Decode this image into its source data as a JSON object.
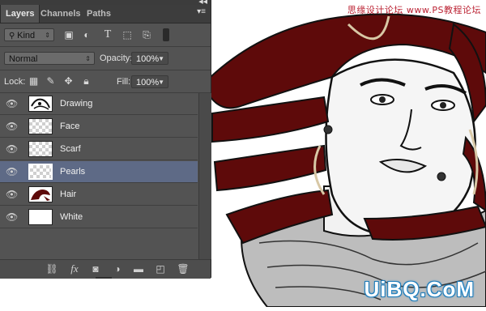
{
  "watermarks": {
    "top": "思缘设计论坛 www.PS教程论坛",
    "bottom": "UiBQ.CoM"
  },
  "panel": {
    "tabs": [
      {
        "label": "Layers",
        "active": true
      },
      {
        "label": "Channels",
        "active": false
      },
      {
        "label": "Paths",
        "active": false
      }
    ],
    "filter": {
      "kind_label": "Kind",
      "icons": [
        "pixel-filter-icon",
        "adjustment-filter-icon",
        "type-filter-icon",
        "shape-filter-icon",
        "smart-object-filter-icon"
      ]
    },
    "blend_mode": "Normal",
    "opacity_label": "Opacity:",
    "opacity_value": "100%",
    "lock_label": "Lock:",
    "lock_icons": [
      "lock-transparent-icon",
      "lock-image-icon",
      "lock-position-icon",
      "lock-all-icon"
    ],
    "fill_label": "Fill:",
    "fill_value": "100%",
    "layers": [
      {
        "name": "Drawing",
        "thumb": "drawing",
        "visible": true,
        "selected": false
      },
      {
        "name": "Face",
        "thumb": "checker",
        "visible": true,
        "selected": false
      },
      {
        "name": "Scarf",
        "thumb": "checker",
        "visible": true,
        "selected": false
      },
      {
        "name": "Pearls",
        "thumb": "checker",
        "visible": true,
        "selected": true
      },
      {
        "name": "Hair",
        "thumb": "hair",
        "visible": true,
        "selected": false
      },
      {
        "name": "White",
        "thumb": "white",
        "visible": true,
        "selected": false
      }
    ],
    "bottom_icons": [
      "link-layers-icon",
      "fx-icon",
      "add-mask-icon",
      "adjustment-layer-icon",
      "group-folder-icon",
      "new-layer-icon",
      "trash-icon"
    ],
    "fx_text": "fx"
  },
  "colors": {
    "hair": "#5e0a0a",
    "selected_row": "#5e6a86",
    "panel_bg": "#535353"
  }
}
